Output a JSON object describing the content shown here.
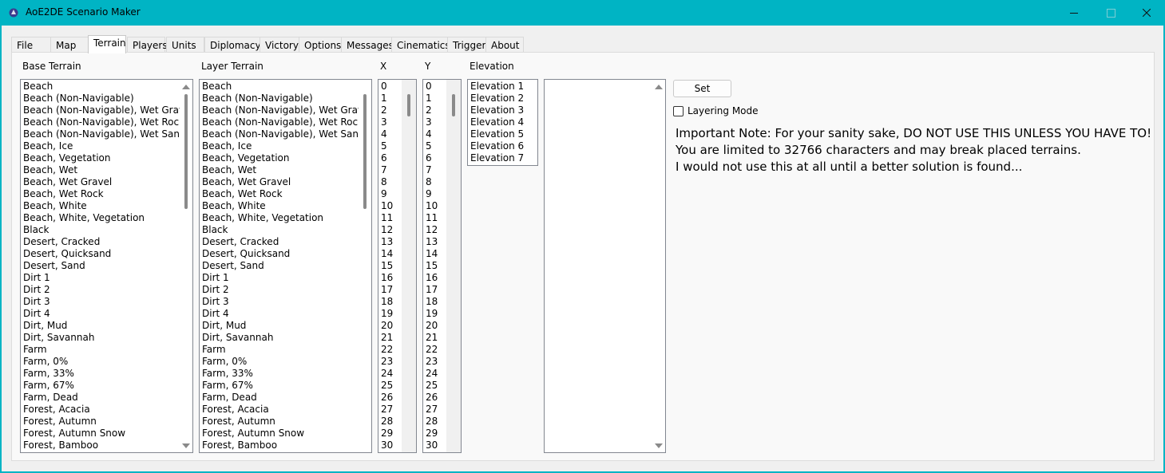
{
  "window": {
    "title": "AoE2DE Scenario Maker",
    "title_bar_color": "#00b4c4"
  },
  "tabs": [
    "File",
    "Map",
    "Terrain",
    "Players",
    "Units",
    "Diplomacy",
    "Victory",
    "Options",
    "Messages",
    "Cinematics",
    "Trigger",
    "About"
  ],
  "active_tab": "Terrain",
  "labels": {
    "base_terrain": "Base Terrain",
    "layer_terrain": "Layer Terrain",
    "x": "X",
    "y": "Y",
    "elevation": "Elevation"
  },
  "terrain_list": [
    "Beach",
    "Beach (Non-Navigable)",
    "Beach (Non-Navigable), Wet Gravel",
    "Beach (Non-Navigable), Wet Rock",
    "Beach (Non-Navigable), Wet Sand",
    "Beach, Ice",
    "Beach, Vegetation",
    "Beach, Wet",
    "Beach, Wet Gravel",
    "Beach, Wet Rock",
    "Beach, White",
    "Beach, White, Vegetation",
    "Black",
    "Desert, Cracked",
    "Desert, Quicksand",
    "Desert, Sand",
    "Dirt 1",
    "Dirt 2",
    "Dirt 3",
    "Dirt 4",
    "Dirt, Mud",
    "Dirt, Savannah",
    "Farm",
    "Farm, 0%",
    "Farm, 33%",
    "Farm, 67%",
    "Farm, Dead",
    "Forest, Acacia",
    "Forest, Autumn",
    "Forest, Autumn Snow",
    "Forest, Bamboo"
  ],
  "x_values": [
    "0",
    "1",
    "2",
    "3",
    "4",
    "5",
    "6",
    "7",
    "8",
    "9",
    "10",
    "11",
    "12",
    "13",
    "14",
    "15",
    "16",
    "17",
    "18",
    "19",
    "20",
    "21",
    "22",
    "23",
    "24",
    "25",
    "26",
    "27",
    "28",
    "29",
    "30"
  ],
  "y_values": [
    "0",
    "1",
    "2",
    "3",
    "4",
    "5",
    "6",
    "7",
    "8",
    "9",
    "10",
    "11",
    "12",
    "13",
    "14",
    "15",
    "16",
    "17",
    "18",
    "19",
    "20",
    "21",
    "22",
    "23",
    "24",
    "25",
    "26",
    "27",
    "28",
    "29",
    "30"
  ],
  "elevations": [
    "Elevation 1",
    "Elevation 2",
    "Elevation 3",
    "Elevation 4",
    "Elevation 5",
    "Elevation 6",
    "Elevation 7"
  ],
  "set_button": "Set",
  "layering_mode": {
    "label": "Layering Mode",
    "checked": false
  },
  "note_lines": [
    "Important Note: For your sanity sake, DO NOT USE THIS UNLESS YOU HAVE TO!",
    "You are limited to 32766 characters and may break placed terrains.",
    "I would not use this at all until a better solution is found..."
  ]
}
